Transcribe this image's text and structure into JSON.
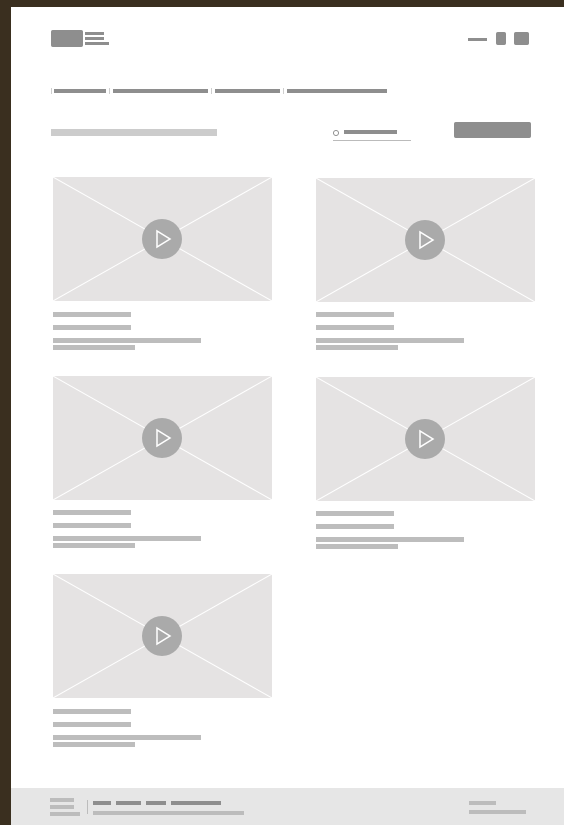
{
  "header": {
    "logo_icon": "logo-placeholder",
    "actions": [
      "menu-dash-icon",
      "square-icon",
      "square-icon"
    ]
  },
  "nav": {
    "items": [
      "",
      "",
      "",
      ""
    ]
  },
  "toolbar": {
    "search_icon": "search-icon",
    "search_placeholder": "",
    "action_button_label": ""
  },
  "videos": [
    {
      "thumbnail": "image-placeholder",
      "play_icon": "play-icon",
      "title": "",
      "meta": "",
      "desc_line1": "",
      "desc_line2": ""
    },
    {
      "thumbnail": "image-placeholder",
      "play_icon": "play-icon",
      "title": "",
      "meta": "",
      "desc_line1": "",
      "desc_line2": ""
    },
    {
      "thumbnail": "image-placeholder",
      "play_icon": "play-icon",
      "title": "",
      "meta": "",
      "desc_line1": "",
      "desc_line2": ""
    },
    {
      "thumbnail": "image-placeholder",
      "play_icon": "play-icon",
      "title": "",
      "meta": "",
      "desc_line1": "",
      "desc_line2": ""
    },
    {
      "thumbnail": "image-placeholder",
      "play_icon": "play-icon",
      "title": "",
      "meta": "",
      "desc_line1": "",
      "desc_line2": ""
    }
  ],
  "footer": {
    "links": [
      "",
      "",
      "",
      ""
    ]
  },
  "colors": {
    "frame": "#3a2f1f",
    "page": "#ffffff",
    "placeholder_dark": "#8e8e8e",
    "placeholder_light": "#bdbdbd",
    "thumbnail_bg": "#e5e3e3",
    "play_circle": "#aaaaaa",
    "footer_bg": "#e6e6e6"
  }
}
